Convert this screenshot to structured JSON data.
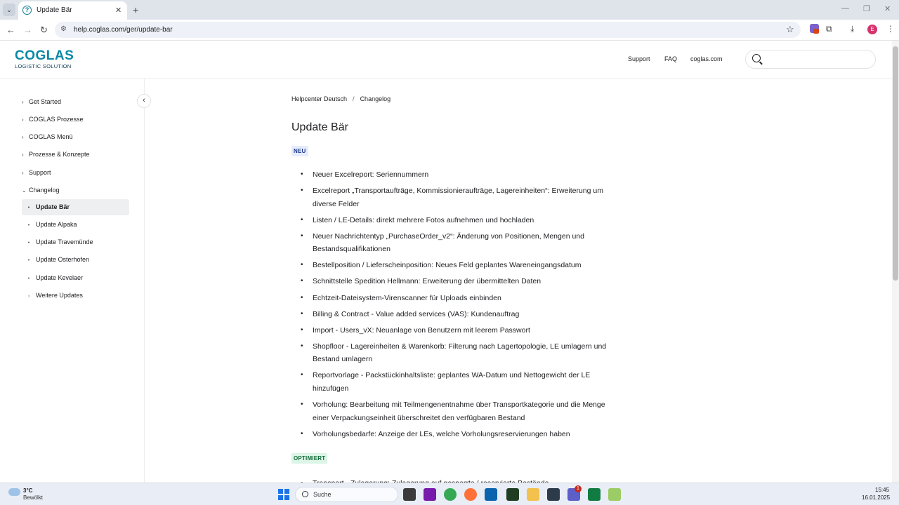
{
  "browser": {
    "tab_title": "Update Bär",
    "url": "help.coglas.com/ger/update-bar"
  },
  "header": {
    "logo_main": "COGLAS",
    "logo_sub": "LOGISTIC SOLUTION",
    "links": [
      "Support",
      "FAQ",
      "coglas.com"
    ]
  },
  "sidebar": {
    "items": [
      {
        "label": "Get Started"
      },
      {
        "label": "COGLAS Prozesse"
      },
      {
        "label": "COGLAS Menü"
      },
      {
        "label": "Prozesse & Konzepte"
      },
      {
        "label": "Support"
      },
      {
        "label": "Changelog"
      }
    ],
    "subitems": [
      {
        "label": "Update Bär"
      },
      {
        "label": "Update Alpaka"
      },
      {
        "label": "Update Travemünde"
      },
      {
        "label": "Update Osterhofen"
      },
      {
        "label": "Update Kevelaer"
      },
      {
        "label": "Weitere Updates"
      }
    ]
  },
  "main": {
    "breadcrumb": [
      "Helpcenter Deutsch",
      "/",
      "Changelog"
    ],
    "title": "Update Bär",
    "tag_new": "NEU",
    "new_items": [
      "Neuer Excelreport: Seriennummern",
      "Excelreport „Transportaufträge, Kommissionieraufträge, Lagereinheiten“: Erweiterung um diverse Felder",
      "Listen / LE-Details: direkt mehrere Fotos aufnehmen und hochladen",
      "Neuer Nachrichtentyp „PurchaseOrder_v2“: Änderung von Positionen, Mengen und Bestandsqualifikationen",
      "Bestellposition / Lieferscheinposition: Neues Feld geplantes Wareneingangsdatum",
      "Schnittstelle Spedition Hellmann: Erweiterung der übermittelten Daten",
      "Echtzeit-Dateisystem-Virenscanner für Uploads einbinden",
      "Billing & Contract - Value added services (VAS): Kundenauftrag",
      "Import - Users_vX: Neuanlage von Benutzern mit leerem Passwort",
      "Shopfloor - Lagereinheiten & Warenkorb: Filterung nach Lagertopologie, LE umlagern und Bestand umlagern",
      "Reportvorlage - Packstückinhaltsliste: geplantes WA-Datum und Nettogewicht der LE hinzufügen",
      "Vorholung: Bearbeitung mit Teilmengenentnahme über Transportkategorie und die Menge einer Verpackungseinheit überschreitet den verfügbaren Bestand",
      "Vorholungsbedarfe: Anzeige der LEs, welche Vorholungsreservierungen haben"
    ],
    "tag_optimized": "OPTIMIERT",
    "optimized_items": [
      "Transport - Zulagerung: Zulagerung auf gesperrte / reservierte Bestände"
    ]
  },
  "taskbar": {
    "weather_temp": "3°C",
    "weather_desc": "Bewölkt",
    "search_label": "Suche",
    "time": "15:45",
    "date": "16.01.2025",
    "notification_count": "1"
  }
}
